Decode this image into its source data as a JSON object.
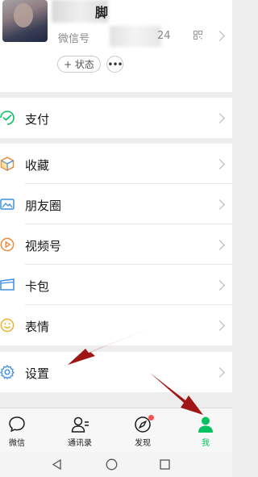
{
  "profile": {
    "name_fragment": "脚",
    "wechat_id_label": "微信号",
    "wechat_id_tail": "24",
    "status_label": "+ 状态",
    "more_label": "•••"
  },
  "menu": [
    {
      "label": "支付",
      "icon": "payment-icon"
    },
    {
      "label": "收藏",
      "icon": "favorites-icon"
    },
    {
      "label": "朋友圈",
      "icon": "moments-icon"
    },
    {
      "label": "视频号",
      "icon": "channels-icon"
    },
    {
      "label": "卡包",
      "icon": "cards-icon"
    },
    {
      "label": "表情",
      "icon": "stickers-icon"
    },
    {
      "label": "设置",
      "icon": "settings-icon"
    }
  ],
  "tabs": [
    {
      "label": "微信",
      "icon": "chat-icon"
    },
    {
      "label": "通讯录",
      "icon": "contacts-icon"
    },
    {
      "label": "发现",
      "icon": "discover-icon",
      "badge": true
    },
    {
      "label": "我",
      "icon": "me-icon",
      "active": true
    }
  ],
  "colors": {
    "accent": "#07c160",
    "badge": "#fa5151",
    "annotation_arrow": "#a01616",
    "background": "#ededed"
  }
}
